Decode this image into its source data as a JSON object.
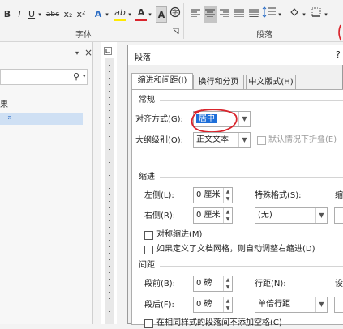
{
  "ribbon": {
    "font_group_label": "字体",
    "paragraph_group_label": "段落",
    "bold": "B",
    "italic": "I",
    "underline": "U",
    "strike": "abc",
    "subscript": "x₂",
    "superscript": "x²",
    "text_effect": "A",
    "highlight": "ab",
    "font_color": "A",
    "char_border": "A"
  },
  "nav_pane": {
    "close": "×",
    "search_icon": "⚲",
    "results_label": "果",
    "heading_marker": "⌅"
  },
  "dialog": {
    "title": "段落",
    "help": "?",
    "tabs": [
      {
        "label": "缩进和间距(I)"
      },
      {
        "label": "换行和分页(P)"
      },
      {
        "label": "中文版式(H)"
      }
    ],
    "general": {
      "section": "常规",
      "alignment_label": "对齐方式(G):",
      "alignment_value": "居中",
      "outline_label": "大纲级别(O):",
      "outline_value": "正文文本",
      "collapse_label": "默认情况下折叠(E)"
    },
    "indent": {
      "section": "缩进",
      "left_label": "左侧(L):",
      "left_value": "0 厘米",
      "right_label": "右侧(R):",
      "right_value": "0 厘米",
      "special_label": "特殊格式(S):",
      "special_value": "(无)",
      "indent_by_label": "缩进",
      "mirror_label": "对称缩进(M)",
      "auto_adjust_label": "如果定义了文档网格，则自动调整右缩进(D)"
    },
    "spacing": {
      "section": "间距",
      "before_label": "段前(B):",
      "before_value": "0 磅",
      "after_label": "段后(F):",
      "after_value": "0 磅",
      "line_spacing_label": "行距(N):",
      "line_spacing_value": "单倍行距",
      "at_label": "设",
      "no_space_label": "在相同样式的段落间不添加空格(C)"
    }
  },
  "colors": {
    "highlight_red": "#d9242c",
    "selection_blue": "#1e6fd9",
    "nav_highlight": "#cfe0f4"
  }
}
